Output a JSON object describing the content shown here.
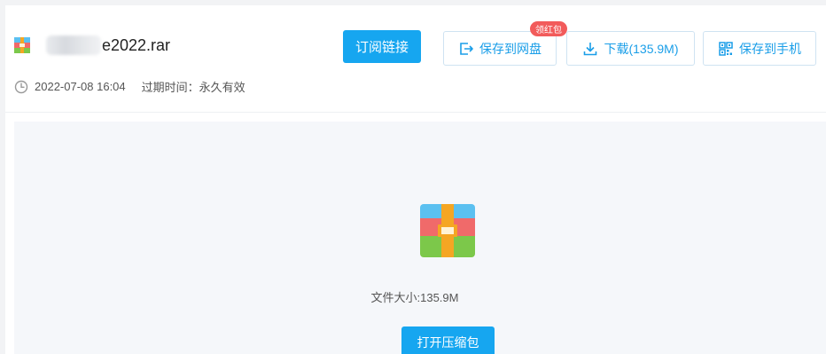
{
  "file": {
    "name_visible": "e2022.rar",
    "date": "2022-07-08 16:04",
    "expiry": "过期时间：永久有效",
    "size_text": "文件大小:135.9M",
    "icon": "rar-archive-icon"
  },
  "actions": {
    "subscribe_label": "订阅链接",
    "save_disk_label": "保存到网盘",
    "save_disk_badge": "领红包",
    "download_label": "下载(135.9M)",
    "save_phone_label": "保存到手机",
    "open_archive_label": "打开压缩包"
  },
  "icons": {
    "clock": "clock-icon",
    "save_disk": "save-to-disk-icon",
    "download": "download-icon",
    "qrcode": "qrcode-icon"
  },
  "colors": {
    "accent": "#16a6f0",
    "badge": "#f25b5b",
    "outline_text": "#1a9ee8"
  }
}
